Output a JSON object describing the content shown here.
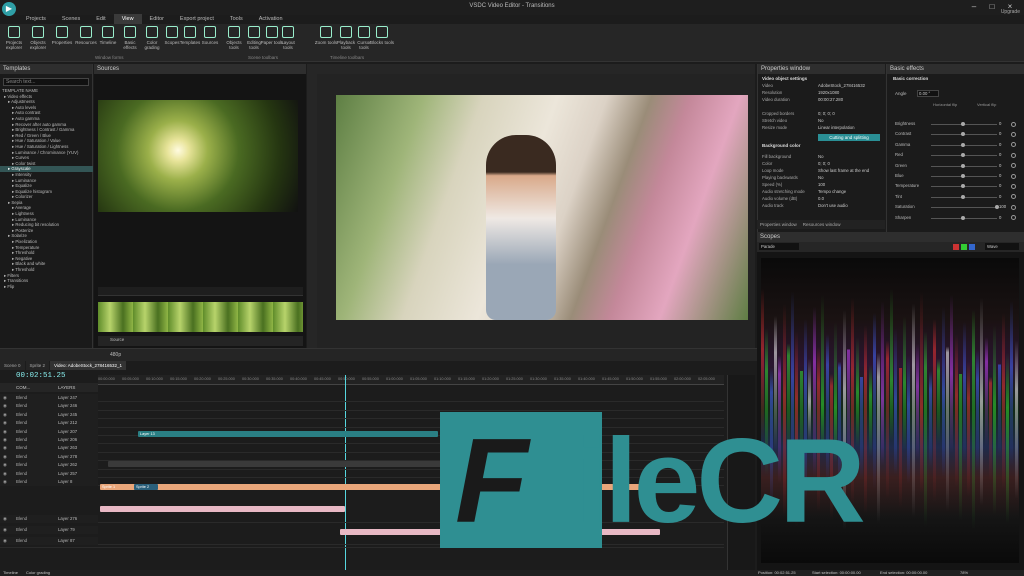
{
  "window": {
    "title": "VSDC Video Editor - Transitions",
    "account_label": "Upgrade"
  },
  "menu": [
    "Projects",
    "Scenes",
    "Edit",
    "View",
    "Editor",
    "Export project",
    "Tools",
    "Activation"
  ],
  "ribbon": {
    "buttons": [
      "Projects explorer",
      "Objects explorer",
      "Properties",
      "Resources",
      "Timeline",
      "Basic effects",
      "Color grading",
      "Scopes",
      "Templates",
      "Sources",
      "Objects tools",
      "Editing tools",
      "Paper tools",
      "Layout tools",
      "Zoom tools",
      "Playback tools",
      "Cursor tools",
      "Blocks tools"
    ],
    "group_window_forms": "Window forms",
    "group_scene_toolbars": "Scene toolbars",
    "group_timeline_toolbars": "Timeline toolbars"
  },
  "templates": {
    "title": "Templates",
    "search_placeholder": "Search text...",
    "items": [
      "TEMPLATE NAME",
      "Video effects",
      "Adjustments",
      "Auto levels",
      "Auto contrast",
      "Auto gamma",
      "Recover after auto gamma",
      "Brightness / Contrast / Gamma",
      "Red / Green / Blue",
      "Hue / Saturation / Value",
      "Hue / Saturation / Lightness",
      "Luminance / Chrominance (YUV)",
      "Curves",
      "Color twist",
      "Grayscale",
      "Intensity",
      "Luminance",
      "Equalize",
      "Equalize histogram",
      "Colorizer",
      "Sepia",
      "Average",
      "Lightness",
      "Luminance",
      "Reducing bit resolution",
      "Posterize",
      "Solarize",
      "Pixelization",
      "Temperature",
      "Threshold",
      "Negative",
      "Black and white",
      "Threshold",
      "Filters",
      "Transitions",
      "Flip"
    ],
    "tabs": [
      "Projects exp...",
      "Objects exp...",
      "Templates"
    ]
  },
  "sources": {
    "title": "Sources",
    "control_label": "Source"
  },
  "properties": {
    "title": "Properties window",
    "section": "Video object settings",
    "rows": [
      {
        "k": "Video",
        "v": "AdobeStock_278416532"
      },
      {
        "k": "Resolution",
        "v": "1920x1080"
      },
      {
        "k": "Video duration",
        "v": "00:00:27.280"
      },
      {
        "k": "Cropped borders",
        "v": "0; 0; 0; 0"
      },
      {
        "k": "Stretch video",
        "v": "No"
      },
      {
        "k": "Resize mode",
        "v": "Linear interpolation"
      },
      {
        "k": "Fill background",
        "v": "No"
      },
      {
        "k": "Color",
        "v": "0; 0; 0"
      },
      {
        "k": "Loop mode",
        "v": "Show last frame at the end"
      },
      {
        "k": "Playing backwards",
        "v": "No"
      },
      {
        "k": "Speed (%)",
        "v": "100"
      },
      {
        "k": "Audio stretching mode",
        "v": "Tempo change"
      },
      {
        "k": "Audio volume (dB)",
        "v": "0.0"
      },
      {
        "k": "Audio track",
        "v": "Don't use audio"
      }
    ],
    "cut_button": "Cutting and splitting",
    "bg_section": "Background color",
    "tabs": [
      "Properties window",
      "Resources window"
    ]
  },
  "effects": {
    "title": "Basic effects",
    "section": "Basic correction",
    "angle_label": "Angle",
    "angle_value": "0.00 °",
    "flip_h": "Horizontal flip",
    "flip_v": "Vertical flip",
    "rows": [
      {
        "k": "Brightness",
        "v": "0"
      },
      {
        "k": "Contrast",
        "v": "0"
      },
      {
        "k": "Gamma",
        "v": "0"
      },
      {
        "k": "Red",
        "v": "0"
      },
      {
        "k": "Green",
        "v": "0"
      },
      {
        "k": "Blue",
        "v": "0"
      },
      {
        "k": "Temperature",
        "v": "0"
      },
      {
        "k": "Tint",
        "v": "0"
      },
      {
        "k": "Saturation",
        "v": "100"
      },
      {
        "k": "Sharpen",
        "v": "0"
      }
    ]
  },
  "scopes": {
    "title": "Scopes",
    "mode": "Parade",
    "channel": "Wave"
  },
  "timeline": {
    "zoom": "480p",
    "tabs": [
      "Scene 0",
      "Sprite 2",
      "Video: AdobeStock_278416532_1"
    ],
    "timecode": "00:02:51.25",
    "head_blend": "COM...",
    "head_layers": "LAYERS",
    "ticks": [
      "00:00.000",
      "00:05.000",
      "00:10.000",
      "00:15.000",
      "00:20.000",
      "00:25.000",
      "00:30.000",
      "00:35.000",
      "00:40.000",
      "00:45.000",
      "00:50.000",
      "00:55.000",
      "01:00.000",
      "01:05.000",
      "01:10.000",
      "01:15.000",
      "01:20.000",
      "01:25.000",
      "01:30.000",
      "01:35.000",
      "01:40.000",
      "01:45.000",
      "01:50.000",
      "01:55.000",
      "02:00.000",
      "02:05.000"
    ],
    "tracks": [
      {
        "blend": "Blend",
        "layer": "Layer 247"
      },
      {
        "blend": "Blend",
        "layer": "Layer 246"
      },
      {
        "blend": "Blend",
        "layer": "Layer 245"
      },
      {
        "blend": "Blend",
        "layer": "Layer 212"
      },
      {
        "blend": "Blend",
        "layer": "Layer 207"
      },
      {
        "blend": "Blend",
        "layer": "Layer 206"
      },
      {
        "blend": "Blend",
        "layer": "Layer 263"
      },
      {
        "blend": "Blend",
        "layer": "Layer 278"
      },
      {
        "blend": "Blend",
        "layer": "Layer 262"
      },
      {
        "blend": "Blend",
        "layer": "Layer 257"
      },
      {
        "blend": "Blend",
        "layer": "Layer 8"
      },
      {
        "blend": "Blend",
        "layer": "Layer 276"
      },
      {
        "blend": "Blend",
        "layer": "Layer 79"
      },
      {
        "blend": "Blend",
        "layer": "Layer 87"
      }
    ],
    "clip_layer13": "Layer 13",
    "clip_sprite1": "Sprite 1",
    "clip_sprite2": "Sprite 2"
  },
  "watermark": {
    "text": "ileCR",
    "letter": "F"
  },
  "status": {
    "tabs": [
      "Timeline",
      "Color grading"
    ],
    "position": "Position:  00:02:51.25",
    "start_sel": "Start selection:  00:00:00.00",
    "end_sel": "End selection:  00:00:00.00",
    "zoom": "78%"
  },
  "colors": {
    "accent": "#2f9fa6",
    "clip_teal": "#2a7f84",
    "clip_peach": "#e9a67a",
    "clip_pink": "#e8b8c4",
    "watermark": "#2f8f92"
  }
}
